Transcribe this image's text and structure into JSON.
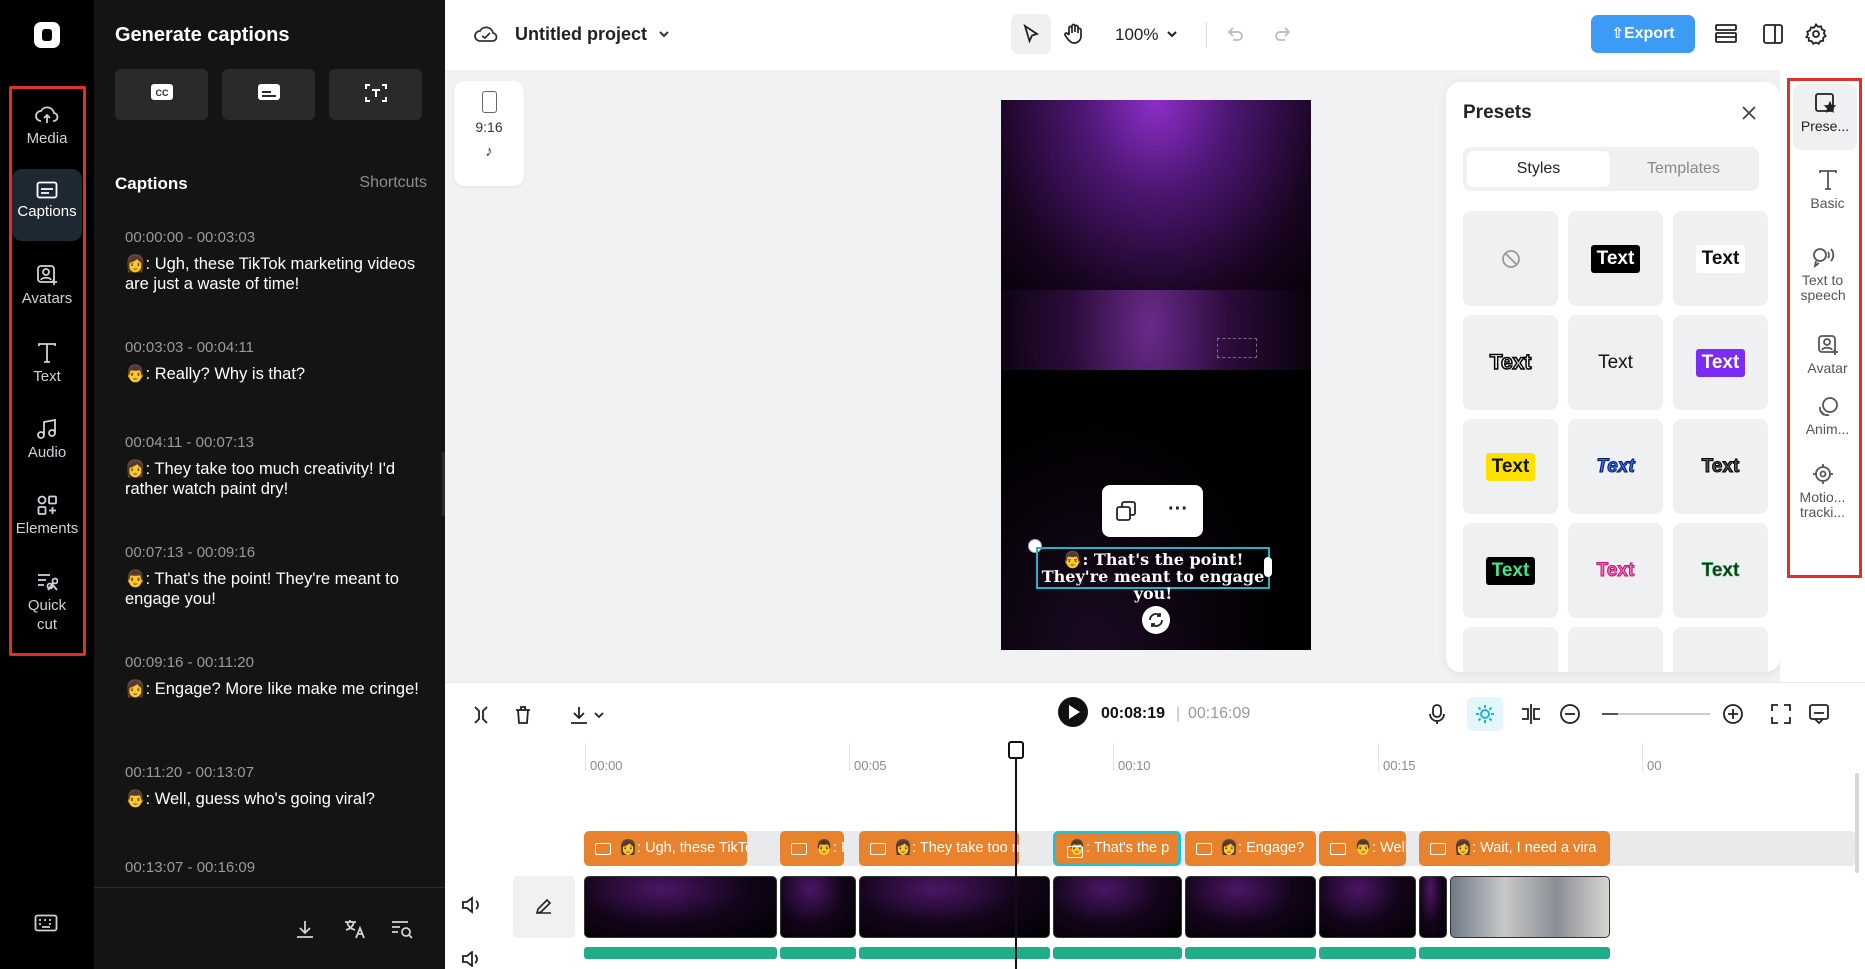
{
  "sidebar": {
    "items": [
      {
        "label": "Media",
        "icon": "cloud-upload-icon"
      },
      {
        "label": "Captions",
        "icon": "captions-icon"
      },
      {
        "label": "Avatars",
        "icon": "avatar-icon"
      },
      {
        "label": "Text",
        "icon": "text-icon"
      },
      {
        "label": "Audio",
        "icon": "music-note-icon"
      },
      {
        "label": "Elements",
        "icon": "elements-icon"
      },
      {
        "label": "Quick cut",
        "icon": "quick-cut-icon"
      }
    ],
    "active": "Captions"
  },
  "captions_panel": {
    "title": "Generate captions",
    "section_title": "Captions",
    "shortcuts_label": "Shortcuts",
    "entries": [
      {
        "time": "00:00:00 - 00:03:03",
        "text": "👩: Ugh, these TikTok marketing videos are just a waste of time!"
      },
      {
        "time": "00:03:03 - 00:04:11",
        "text": "👨: Really? Why is that?"
      },
      {
        "time": "00:04:11 - 00:07:13",
        "text": "👩: They take too much creativity! I'd rather watch paint dry!"
      },
      {
        "time": "00:07:13 - 00:09:16",
        "text": "👨: That's the point! They're meant to engage you!"
      },
      {
        "time": "00:09:16 - 00:11:20",
        "text": "👩: Engage? More like make me cringe!"
      },
      {
        "time": "00:11:20 - 00:13:07",
        "text": "👨: Well, guess who's going viral?"
      },
      {
        "time": "00:13:07 - 00:16:09",
        "text": ""
      }
    ]
  },
  "topbar": {
    "project_title": "Untitled project",
    "zoom": "100%",
    "export_label": "Export"
  },
  "canvas": {
    "ratio_label": "9:16",
    "caption_text": "👨: That's the point! They're meant to engage you!"
  },
  "presets": {
    "title": "Presets",
    "tabs": [
      "Styles",
      "Templates"
    ],
    "active_tab": "Styles",
    "tile_text": "Text"
  },
  "right_rail": {
    "items": [
      {
        "label": "Prese...",
        "icon": "presets-icon"
      },
      {
        "label": "Basic",
        "icon": "text-icon"
      },
      {
        "label": "Text to speech",
        "icon": "speech-icon"
      },
      {
        "label": "Avatar",
        "icon": "avatar-icon"
      },
      {
        "label": "Anim...",
        "icon": "animation-icon"
      },
      {
        "label": "Motio... tracki...",
        "icon": "motion-tracking-icon"
      }
    ]
  },
  "timeline": {
    "current_time": "00:08:19",
    "total_time": "00:16:09",
    "ruler": [
      "00:00",
      "00:05",
      "00:10",
      "00:15"
    ],
    "caption_clips": [
      "👩: Ugh, these TikTok",
      "👨: R",
      "👩: They take too mu",
      "👨: That's the p",
      "👩: Engage?",
      "👨: Well",
      "👩: Wait, I need a vira"
    ]
  }
}
